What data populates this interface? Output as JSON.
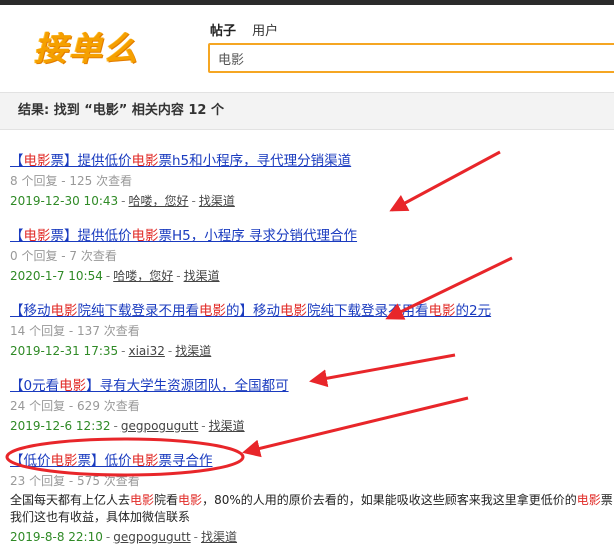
{
  "logo": {
    "text": "接单么"
  },
  "search": {
    "tabs": [
      {
        "label": "帖子",
        "active": true
      },
      {
        "label": "用户",
        "active": false
      }
    ],
    "query": "电影"
  },
  "result_summary": "结果: 找到 “电影” 相关内容 12 个",
  "results": [
    {
      "title_parts": [
        {
          "t": "【"
        },
        {
          "t": "电影",
          "hl": true
        },
        {
          "t": "票】提供低价"
        },
        {
          "t": "电影",
          "hl": true
        },
        {
          "t": "票h5和小程序，寻代理分销渠道"
        }
      ],
      "stats": "8 个回复 - 125 次查看",
      "date": "2019-12-30 10:43",
      "author": "哈喽，您好",
      "category": "找渠道"
    },
    {
      "title_parts": [
        {
          "t": "【"
        },
        {
          "t": "电影",
          "hl": true
        },
        {
          "t": "票】提供低价"
        },
        {
          "t": "电影",
          "hl": true
        },
        {
          "t": "票H5，小程序 寻求分销代理合作"
        }
      ],
      "stats": "0 个回复 - 7 次查看",
      "date": "2020-1-7 10:54",
      "author": "哈喽，您好",
      "category": "找渠道"
    },
    {
      "title_parts": [
        {
          "t": "【移动"
        },
        {
          "t": "电影",
          "hl": true
        },
        {
          "t": "院纯下载登录不用看"
        },
        {
          "t": "电影",
          "hl": true
        },
        {
          "t": "的】移动"
        },
        {
          "t": "电影",
          "hl": true
        },
        {
          "t": "院纯下载登录不用看"
        },
        {
          "t": "电影",
          "hl": true
        },
        {
          "t": "的2元"
        }
      ],
      "stats": "14 个回复 - 137 次查看",
      "date": "2019-12-31 17:35",
      "author": "xiai32",
      "category": "找渠道"
    },
    {
      "title_parts": [
        {
          "t": "【0元看"
        },
        {
          "t": "电影",
          "hl": true
        },
        {
          "t": "】寻有大学生资源团队，全国都可"
        }
      ],
      "stats": "24 个回复 - 629 次查看",
      "date": "2019-12-6 12:32",
      "author": "gegpogugutt",
      "category": "找渠道"
    },
    {
      "title_parts": [
        {
          "t": "【低价"
        },
        {
          "t": "电影",
          "hl": true
        },
        {
          "t": "票】低价"
        },
        {
          "t": "电影",
          "hl": true
        },
        {
          "t": "票寻合作"
        }
      ],
      "stats": "23 个回复 - 575 次查看",
      "desc_parts": [
        {
          "t": "全国每天都有上亿人去"
        },
        {
          "t": "电影",
          "hl": true
        },
        {
          "t": "院看"
        },
        {
          "t": "电影",
          "hl": true
        },
        {
          "t": "，80%的人用的原价去看的，如果能吸收这些顾客来我这里拿更低价的"
        },
        {
          "t": "电影",
          "hl": true
        },
        {
          "t": "票我们这也有收益，具体加微信联系"
        }
      ],
      "date": "2019-8-8 22:10",
      "author": "gegpogugutt",
      "category": "找渠道"
    }
  ],
  "annotation_color": "#e8262a"
}
